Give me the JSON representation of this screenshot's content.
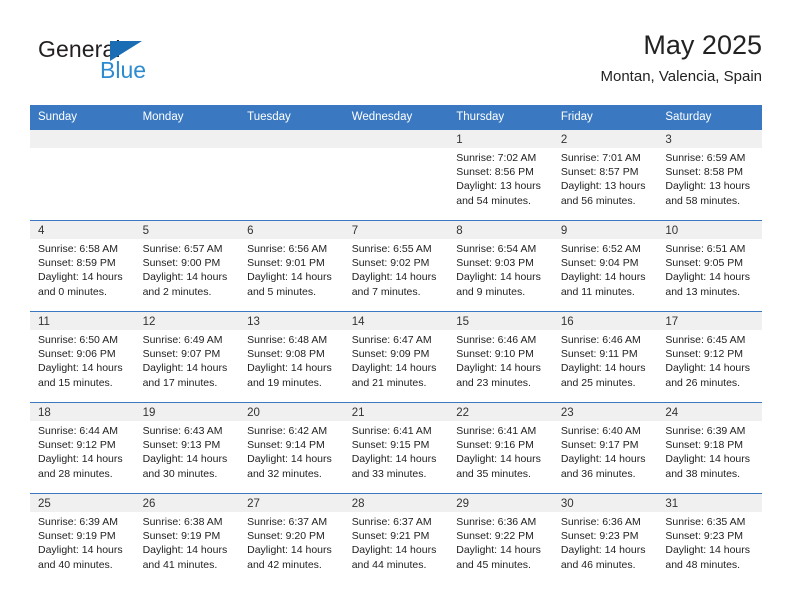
{
  "logo": {
    "word_top": "General",
    "word_bottom": "Blue",
    "triangle_color": "#1a6cb5",
    "blue_text_color": "#2e8bd0"
  },
  "header": {
    "title": "May 2025",
    "subtitle": "Montan, Valencia, Spain"
  },
  "theme": {
    "header_row_bg": "#3a79c2",
    "header_row_text": "#ffffff",
    "daynum_bg": "#f0f0f0",
    "row_divider": "#3a79c2"
  },
  "weekdays": [
    "Sunday",
    "Monday",
    "Tuesday",
    "Wednesday",
    "Thursday",
    "Friday",
    "Saturday"
  ],
  "labels": {
    "sunrise_prefix": "Sunrise:",
    "sunset_prefix": "Sunset:",
    "daylight_prefix": "Daylight:"
  },
  "weeks": [
    [
      {
        "day": ""
      },
      {
        "day": ""
      },
      {
        "day": ""
      },
      {
        "day": ""
      },
      {
        "day": "1",
        "sunrise": "Sunrise: 7:02 AM",
        "sunset": "Sunset: 8:56 PM",
        "daylight": "Daylight: 13 hours and 54 minutes."
      },
      {
        "day": "2",
        "sunrise": "Sunrise: 7:01 AM",
        "sunset": "Sunset: 8:57 PM",
        "daylight": "Daylight: 13 hours and 56 minutes."
      },
      {
        "day": "3",
        "sunrise": "Sunrise: 6:59 AM",
        "sunset": "Sunset: 8:58 PM",
        "daylight": "Daylight: 13 hours and 58 minutes."
      }
    ],
    [
      {
        "day": "4",
        "sunrise": "Sunrise: 6:58 AM",
        "sunset": "Sunset: 8:59 PM",
        "daylight": "Daylight: 14 hours and 0 minutes."
      },
      {
        "day": "5",
        "sunrise": "Sunrise: 6:57 AM",
        "sunset": "Sunset: 9:00 PM",
        "daylight": "Daylight: 14 hours and 2 minutes."
      },
      {
        "day": "6",
        "sunrise": "Sunrise: 6:56 AM",
        "sunset": "Sunset: 9:01 PM",
        "daylight": "Daylight: 14 hours and 5 minutes."
      },
      {
        "day": "7",
        "sunrise": "Sunrise: 6:55 AM",
        "sunset": "Sunset: 9:02 PM",
        "daylight": "Daylight: 14 hours and 7 minutes."
      },
      {
        "day": "8",
        "sunrise": "Sunrise: 6:54 AM",
        "sunset": "Sunset: 9:03 PM",
        "daylight": "Daylight: 14 hours and 9 minutes."
      },
      {
        "day": "9",
        "sunrise": "Sunrise: 6:52 AM",
        "sunset": "Sunset: 9:04 PM",
        "daylight": "Daylight: 14 hours and 11 minutes."
      },
      {
        "day": "10",
        "sunrise": "Sunrise: 6:51 AM",
        "sunset": "Sunset: 9:05 PM",
        "daylight": "Daylight: 14 hours and 13 minutes."
      }
    ],
    [
      {
        "day": "11",
        "sunrise": "Sunrise: 6:50 AM",
        "sunset": "Sunset: 9:06 PM",
        "daylight": "Daylight: 14 hours and 15 minutes."
      },
      {
        "day": "12",
        "sunrise": "Sunrise: 6:49 AM",
        "sunset": "Sunset: 9:07 PM",
        "daylight": "Daylight: 14 hours and 17 minutes."
      },
      {
        "day": "13",
        "sunrise": "Sunrise: 6:48 AM",
        "sunset": "Sunset: 9:08 PM",
        "daylight": "Daylight: 14 hours and 19 minutes."
      },
      {
        "day": "14",
        "sunrise": "Sunrise: 6:47 AM",
        "sunset": "Sunset: 9:09 PM",
        "daylight": "Daylight: 14 hours and 21 minutes."
      },
      {
        "day": "15",
        "sunrise": "Sunrise: 6:46 AM",
        "sunset": "Sunset: 9:10 PM",
        "daylight": "Daylight: 14 hours and 23 minutes."
      },
      {
        "day": "16",
        "sunrise": "Sunrise: 6:46 AM",
        "sunset": "Sunset: 9:11 PM",
        "daylight": "Daylight: 14 hours and 25 minutes."
      },
      {
        "day": "17",
        "sunrise": "Sunrise: 6:45 AM",
        "sunset": "Sunset: 9:12 PM",
        "daylight": "Daylight: 14 hours and 26 minutes."
      }
    ],
    [
      {
        "day": "18",
        "sunrise": "Sunrise: 6:44 AM",
        "sunset": "Sunset: 9:12 PM",
        "daylight": "Daylight: 14 hours and 28 minutes."
      },
      {
        "day": "19",
        "sunrise": "Sunrise: 6:43 AM",
        "sunset": "Sunset: 9:13 PM",
        "daylight": "Daylight: 14 hours and 30 minutes."
      },
      {
        "day": "20",
        "sunrise": "Sunrise: 6:42 AM",
        "sunset": "Sunset: 9:14 PM",
        "daylight": "Daylight: 14 hours and 32 minutes."
      },
      {
        "day": "21",
        "sunrise": "Sunrise: 6:41 AM",
        "sunset": "Sunset: 9:15 PM",
        "daylight": "Daylight: 14 hours and 33 minutes."
      },
      {
        "day": "22",
        "sunrise": "Sunrise: 6:41 AM",
        "sunset": "Sunset: 9:16 PM",
        "daylight": "Daylight: 14 hours and 35 minutes."
      },
      {
        "day": "23",
        "sunrise": "Sunrise: 6:40 AM",
        "sunset": "Sunset: 9:17 PM",
        "daylight": "Daylight: 14 hours and 36 minutes."
      },
      {
        "day": "24",
        "sunrise": "Sunrise: 6:39 AM",
        "sunset": "Sunset: 9:18 PM",
        "daylight": "Daylight: 14 hours and 38 minutes."
      }
    ],
    [
      {
        "day": "25",
        "sunrise": "Sunrise: 6:39 AM",
        "sunset": "Sunset: 9:19 PM",
        "daylight": "Daylight: 14 hours and 40 minutes."
      },
      {
        "day": "26",
        "sunrise": "Sunrise: 6:38 AM",
        "sunset": "Sunset: 9:19 PM",
        "daylight": "Daylight: 14 hours and 41 minutes."
      },
      {
        "day": "27",
        "sunrise": "Sunrise: 6:37 AM",
        "sunset": "Sunset: 9:20 PM",
        "daylight": "Daylight: 14 hours and 42 minutes."
      },
      {
        "day": "28",
        "sunrise": "Sunrise: 6:37 AM",
        "sunset": "Sunset: 9:21 PM",
        "daylight": "Daylight: 14 hours and 44 minutes."
      },
      {
        "day": "29",
        "sunrise": "Sunrise: 6:36 AM",
        "sunset": "Sunset: 9:22 PM",
        "daylight": "Daylight: 14 hours and 45 minutes."
      },
      {
        "day": "30",
        "sunrise": "Sunrise: 6:36 AM",
        "sunset": "Sunset: 9:23 PM",
        "daylight": "Daylight: 14 hours and 46 minutes."
      },
      {
        "day": "31",
        "sunrise": "Sunrise: 6:35 AM",
        "sunset": "Sunset: 9:23 PM",
        "daylight": "Daylight: 14 hours and 48 minutes."
      }
    ]
  ]
}
